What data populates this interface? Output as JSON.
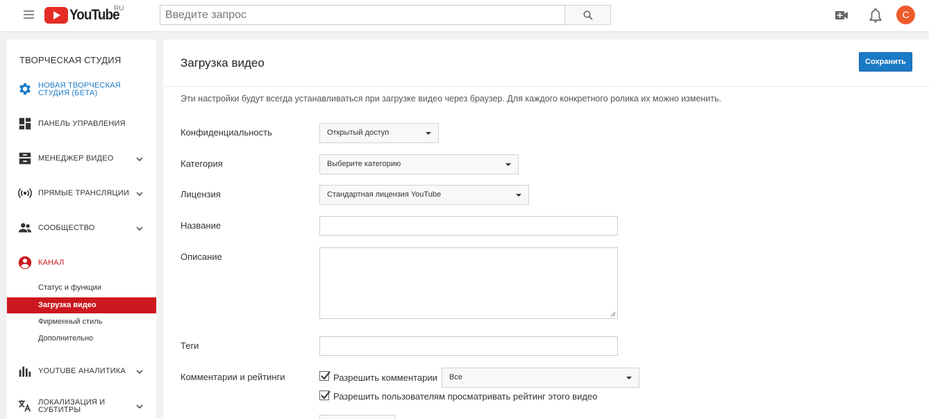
{
  "header": {
    "logo_text": "YouTube",
    "logo_region": "RU",
    "search_placeholder": "Введите запрос",
    "avatar_letter": "C"
  },
  "sidebar": {
    "title": "ТВОРЧЕСКАЯ СТУДИЯ",
    "items": [
      {
        "label_line1": "НОВАЯ ТВОРЧЕСКАЯ",
        "label_line2": "СТУДИЯ (БЕТА)",
        "icon": "gear-icon",
        "color": "#1b7ac5"
      },
      {
        "label": "ПАНЕЛЬ УПРАВЛЕНИЯ",
        "icon": "dashboard-icon"
      },
      {
        "label": "МЕНЕДЖЕР ВИДЕО",
        "icon": "video-manager-icon"
      },
      {
        "label": "ПРЯМЫЕ ТРАНСЛЯЦИИ",
        "icon": "live-broadcast-icon"
      },
      {
        "label": "СООБЩЕСТВО",
        "icon": "community-icon"
      },
      {
        "label": "КАНАЛ",
        "icon": "channel-icon",
        "color": "#cc181e"
      },
      {
        "label": "YOUTUBE АНАЛИТИКА",
        "icon": "analytics-icon"
      },
      {
        "label_line1": "ЛОКАЛИЗАЦИЯ И",
        "label_line2": "СУБТИТРЫ",
        "icon": "translate-icon"
      }
    ],
    "channel_sub_items": [
      "Статус и функции",
      "Загрузка видео",
      "Фирменный стиль",
      "Дополнительно"
    ],
    "active_sub_item": "Загрузка видео"
  },
  "main": {
    "title": "Загрузка видео",
    "save_label": "Сохранить",
    "intro": "Эти настройки будут всегда устанавливаться при загрузке видео через браузер. Для каждого конкретного ролика их можно изменить.",
    "fields": {
      "privacy_label": "Конфиденциальность",
      "privacy_value": "Открытый доступ",
      "category_label": "Категория",
      "category_value": "Выберите категорию",
      "license_label": "Лицензия",
      "license_value": "Стандартная лицензия YouTube",
      "title_label": "Название",
      "title_value": "",
      "description_label": "Описание",
      "description_value": "",
      "tags_label": "Теги",
      "tags_value": "",
      "comments_label": "Комментарии и рейтинги",
      "allow_comments_label": "Разрешить комментарии",
      "allow_comments_checked": true,
      "comments_filter_value": "Все",
      "allow_ratings_label": "Разрешить пользователям просматривать рейтинг этого видео",
      "allow_ratings_checked": true
    }
  },
  "colors": {
    "brand_red": "#cc181e",
    "save_blue": "#1b7ac5",
    "avatar": "#ef5c2c"
  }
}
